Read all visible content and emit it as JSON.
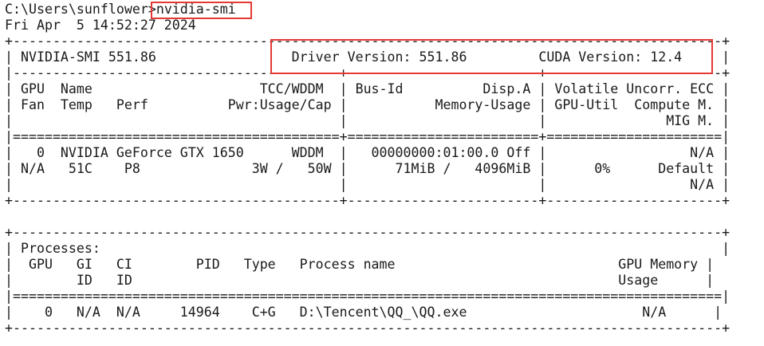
{
  "terminal": {
    "prompt": "C:\\Users\\sunflower>",
    "command": "nvidia-smi",
    "timestamp": "Fri Apr  5 14:52:27 2024"
  },
  "smi_output": [
    "+-----------------------------------------------------------------------------------------+",
    "| NVIDIA-SMI 551.86                 Driver Version: 551.86         CUDA Version: 12.4     |",
    "|-----------------------------------------+------------------------+----------------------+",
    "| GPU  Name                     TCC/WDDM  | Bus-Id          Disp.A | Volatile Uncorr. ECC |",
    "| Fan  Temp   Perf          Pwr:Usage/Cap |           Memory-Usage | GPU-Util  Compute M. |",
    "|                                         |                        |               MIG M. |",
    "|=========================================+========================+======================|",
    "|   0  NVIDIA GeForce GTX 1650      WDDM  |   00000000:01:00.0 Off |                  N/A |",
    "| N/A   51C    P8              3W /   50W |      71MiB /   4096MiB |      0%      Default |",
    "|                                         |                        |                  N/A |",
    "+-----------------------------------------+------------------------+----------------------+",
    "",
    "+-----------------------------------------------------------------------------------------+",
    "| Processes:                                                                              |",
    "|  GPU   GI   CI        PID   Type   Process name                            GPU Memory |",
    "|        ID   ID                                                             Usage      |",
    "|=========================================================================================|",
    "|    0   N/A  N/A     14964    C+G   D:\\Tencent\\QQ_\\QQ.exe                      N/A      |",
    "+-----------------------------------------------------------------------------------------+"
  ]
}
